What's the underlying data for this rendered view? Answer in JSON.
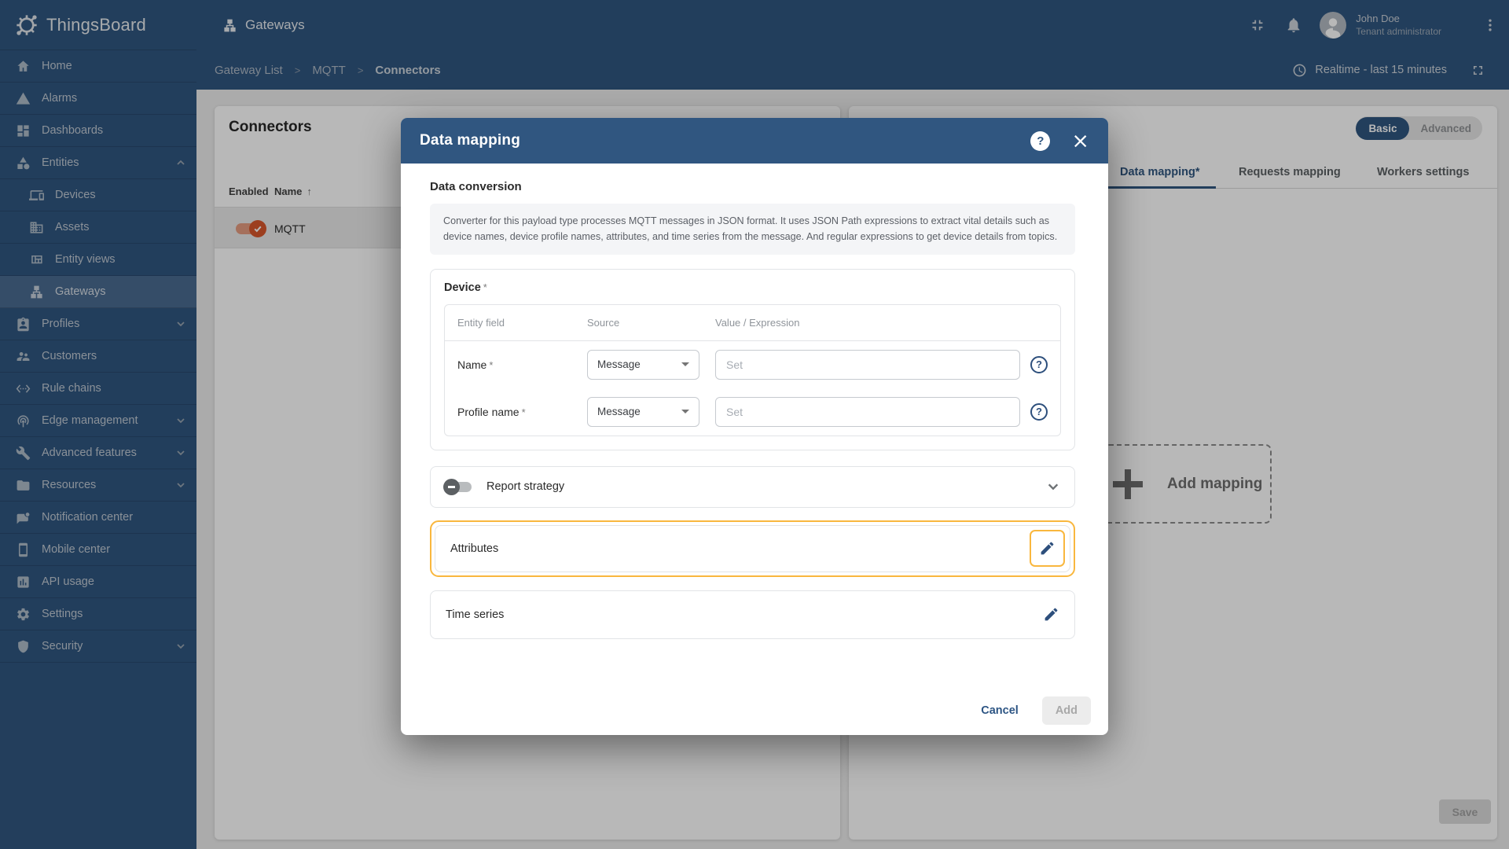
{
  "app": {
    "name": "ThingsBoard"
  },
  "header": {
    "page_title": "Gateways",
    "user": {
      "name": "John Doe",
      "role": "Tenant administrator"
    }
  },
  "breadcrumb": {
    "items": [
      "Gateway List",
      "MQTT",
      "Connectors"
    ],
    "separator": ">"
  },
  "subbar": {
    "realtime_label": "Realtime - last 15 minutes"
  },
  "sidebar": {
    "items": [
      {
        "label": "Home",
        "icon": "home-icon"
      },
      {
        "label": "Alarms",
        "icon": "alarm-icon"
      },
      {
        "label": "Dashboards",
        "icon": "dashboards-icon"
      },
      {
        "label": "Entities",
        "icon": "entities-icon",
        "expanded": true
      },
      {
        "label": "Devices",
        "icon": "devices-icon",
        "child": true
      },
      {
        "label": "Assets",
        "icon": "assets-icon",
        "child": true
      },
      {
        "label": "Entity views",
        "icon": "entity-views-icon",
        "child": true
      },
      {
        "label": "Gateways",
        "icon": "gateways-icon",
        "child": true,
        "selected": true
      },
      {
        "label": "Profiles",
        "icon": "profiles-icon",
        "expandable": true
      },
      {
        "label": "Customers",
        "icon": "customers-icon"
      },
      {
        "label": "Rule chains",
        "icon": "rule-chains-icon"
      },
      {
        "label": "Edge management",
        "icon": "edge-icon",
        "expandable": true
      },
      {
        "label": "Advanced features",
        "icon": "advanced-icon",
        "expandable": true
      },
      {
        "label": "Resources",
        "icon": "resources-icon",
        "expandable": true
      },
      {
        "label": "Notification center",
        "icon": "notification-icon"
      },
      {
        "label": "Mobile center",
        "icon": "mobile-icon"
      },
      {
        "label": "API usage",
        "icon": "api-icon"
      },
      {
        "label": "Settings",
        "icon": "settings-icon"
      },
      {
        "label": "Security",
        "icon": "security-icon",
        "expandable": true
      }
    ]
  },
  "connectors_panel": {
    "title": "Connectors",
    "col_enabled": "Enabled",
    "col_name": "Name",
    "sort_arrow": "↑",
    "rows": [
      {
        "name": "MQTT",
        "enabled": true
      }
    ]
  },
  "right_panel": {
    "mode": {
      "basic": "Basic",
      "advanced": "Advanced",
      "selected": "Basic"
    },
    "tabs": [
      {
        "label": "Data mapping*",
        "active": true
      },
      {
        "label": "Requests mapping",
        "active": false
      },
      {
        "label": "Workers settings",
        "active": false
      }
    ],
    "add_mapping_label": "Add mapping",
    "save_label": "Save"
  },
  "modal": {
    "title": "Data mapping",
    "help_glyph": "?",
    "close_glyph": "×",
    "section_title": "Data conversion",
    "description": "Converter for this payload type processes MQTT messages in JSON format. It uses JSON Path expressions to extract vital details such as device names, device profile names, attributes, and time series from the message. And regular expressions to get device details from topics.",
    "required_marker": "*",
    "device": {
      "title": "Device",
      "col_field": "Entity field",
      "col_source": "Source",
      "col_value": "Value / Expression",
      "rows": [
        {
          "field": "Name",
          "source": "Message",
          "placeholder": "Set",
          "help_glyph": "?"
        },
        {
          "field": "Profile name",
          "source": "Message",
          "placeholder": "Set",
          "help_glyph": "?"
        }
      ]
    },
    "report_strategy_label": "Report strategy",
    "attributes_label": "Attributes",
    "time_series_label": "Time series",
    "cancel_label": "Cancel",
    "add_label": "Add"
  },
  "colors": {
    "primary": "#305680",
    "highlight": "#F9B73E",
    "toggle_on_thumb": "#D9572B",
    "toggle_on_track": "#E59C80",
    "page_bg": "#EDEDED"
  }
}
